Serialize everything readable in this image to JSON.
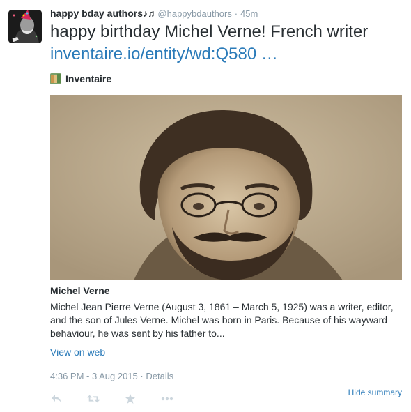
{
  "tweet": {
    "display_name": "happy bday authors",
    "name_glyph": "♪♫",
    "screen_name": "@happybdauthors",
    "separator": "·",
    "age": "45m",
    "text_plain": "happy birthday Michel Verne! French writer",
    "link_text": "inventaire.io/entity/wd:Q580 …"
  },
  "card": {
    "provider_name": "Inventaire",
    "title": "Michel Verne",
    "description": "Michel Jean Pierre Verne (August 3, 1861 – March 5, 1925) was a writer, editor, and the son of Jules Verne. Michel was born in Paris. Because of his wayward behaviour, he was sent by his father to...",
    "view_link": "View on web"
  },
  "meta": {
    "timestamp": "4:36 PM - 3 Aug 2015",
    "separator": "·",
    "details": "Details",
    "hide_summary": "Hide summary"
  },
  "actions": [
    "reply-icon",
    "retweet-icon",
    "favorite-icon",
    "more-icon"
  ],
  "colors": {
    "link": "#2b7bb9",
    "muted": "#8899a6",
    "text": "#292f33",
    "icon": "#ccd6dd"
  }
}
